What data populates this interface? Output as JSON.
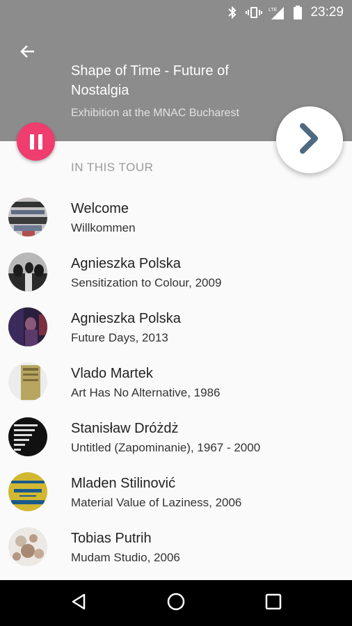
{
  "status_bar": {
    "time": "23:29",
    "icons": [
      "bluetooth-icon",
      "vibrate-icon",
      "lte-signal-icon",
      "battery-icon"
    ],
    "network_label": "LTE"
  },
  "header": {
    "back_icon": "arrow-back-icon",
    "title": "Shape of Time - Future of Nostalgia",
    "subtitle": "Exhibition at the MNAC Bucharest",
    "background_color": "#8c8c8c"
  },
  "controls": {
    "pause_icon": "pause-icon",
    "pause_color": "#ee3d6e",
    "next_icon": "chevron-right-icon",
    "next_color": "#4f6a80"
  },
  "section_label": "IN THIS TOUR",
  "tour_items": [
    {
      "title": "Welcome",
      "subtitle": "Willkommen"
    },
    {
      "title": "Agnieszka Polska",
      "subtitle": "Sensitization to Colour, 2009"
    },
    {
      "title": "Agnieszka Polska",
      "subtitle": "Future Days, 2013"
    },
    {
      "title": "Vlado Martek",
      "subtitle": "Art Has No Alternative, 1986"
    },
    {
      "title": "Stanisław Dróżdż",
      "subtitle": "Untitled (Zapominanie), 1967 - 2000"
    },
    {
      "title": "Mladen Stilinović",
      "subtitle": "Material Value of Laziness, 2006"
    },
    {
      "title": "Tobias Putrih",
      "subtitle": "Mudam Studio, 2006"
    }
  ],
  "nav_bar": {
    "icons": [
      "back-triangle-icon",
      "home-circle-icon",
      "recents-square-icon"
    ]
  }
}
